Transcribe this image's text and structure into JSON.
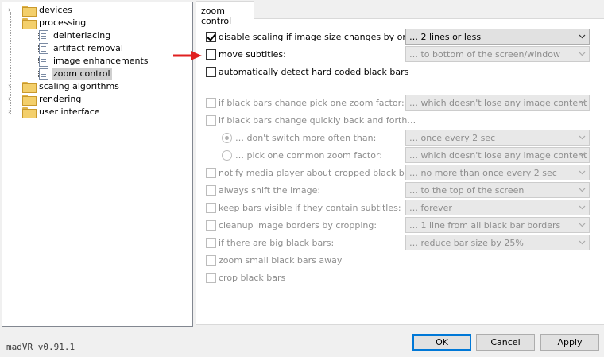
{
  "tree": {
    "items": [
      {
        "label": "devices",
        "type": "folder",
        "expanded": false
      },
      {
        "label": "processing",
        "type": "folder",
        "expanded": true
      },
      {
        "label": "deinterlacing",
        "type": "page"
      },
      {
        "label": "artifact removal",
        "type": "page"
      },
      {
        "label": "image enhancements",
        "type": "page"
      },
      {
        "label": "zoom control",
        "type": "page",
        "selected": true
      },
      {
        "label": "scaling algorithms",
        "type": "folder",
        "expanded": false
      },
      {
        "label": "rendering",
        "type": "folder",
        "expanded": false
      },
      {
        "label": "user interface",
        "type": "folder",
        "expanded": false
      }
    ]
  },
  "tab": {
    "label": "zoom control"
  },
  "options": [
    {
      "label": "disable scaling if image size changes by only:",
      "checked": true,
      "enabled": true,
      "value": "… 2 lines or less",
      "combo_enabled": true
    },
    {
      "label": "move subtitles:",
      "checked": false,
      "enabled": true,
      "value": "… to bottom of the screen/window",
      "combo_enabled": false
    },
    {
      "label": "automatically detect hard coded black bars",
      "checked": false,
      "enabled": true
    },
    {
      "label": "if black bars change pick one zoom factor:",
      "checked": false,
      "enabled": false,
      "value": "… which doesn't lose any image content"
    },
    {
      "label": "if black bars change quickly back and forth…",
      "checked": false,
      "enabled": false
    },
    {
      "label": "… don't switch more often than:",
      "radio": true,
      "selected": true,
      "enabled": false,
      "value": "… once every 2 sec"
    },
    {
      "label": "… pick one common zoom factor:",
      "radio": true,
      "selected": false,
      "enabled": false,
      "value": "… which doesn't lose any image content"
    },
    {
      "label": "notify media player about cropped black bars:",
      "checked": false,
      "enabled": false,
      "value": "… no more than once every 2 sec"
    },
    {
      "label": "always shift the image:",
      "checked": false,
      "enabled": false,
      "value": "… to the top of the screen"
    },
    {
      "label": "keep bars visible if they contain subtitles:",
      "checked": false,
      "enabled": false,
      "value": "… forever"
    },
    {
      "label": "cleanup image borders by cropping:",
      "checked": false,
      "enabled": false,
      "value": "… 1 line from all black bar borders"
    },
    {
      "label": "if there are big black bars:",
      "checked": false,
      "enabled": false,
      "value": "… reduce bar size by 25%"
    },
    {
      "label": "zoom small black bars away",
      "checked": false,
      "enabled": false
    },
    {
      "label": "crop black bars",
      "checked": false,
      "enabled": false
    }
  ],
  "annotation": {
    "arrow_color": "#e02020",
    "points_to": "move subtitles:"
  },
  "footer": {
    "version": "madVR v0.91.1",
    "ok_label": "OK",
    "cancel_label": "Cancel",
    "apply_label": "Apply"
  },
  "colors": {
    "selection": "#cfcfcf",
    "default_button_border": "#0078d7",
    "disabled_text": "#8d8d8d"
  }
}
